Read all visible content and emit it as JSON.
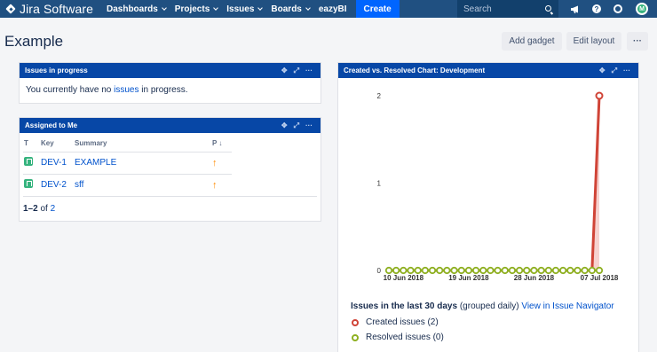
{
  "nav": {
    "logo": "Jira Software",
    "items": [
      {
        "label": "Dashboards"
      },
      {
        "label": "Projects"
      },
      {
        "label": "Issues"
      },
      {
        "label": "Boards"
      }
    ],
    "plain_item": "eazyBI",
    "create": "Create",
    "search_placeholder": "Search",
    "avatar_initial": "M"
  },
  "page": {
    "title": "Example",
    "add_gadget": "Add gadget",
    "edit_layout": "Edit layout",
    "more": "···"
  },
  "gadget_in_progress": {
    "title": "Issues in progress",
    "text_before": "You currently have no ",
    "link": "issues",
    "text_after": " in progress."
  },
  "gadget_assigned": {
    "title": "Assigned to Me",
    "columns": {
      "t": "T",
      "key": "Key",
      "summary": "Summary",
      "p": "P ↓"
    },
    "rows": [
      {
        "key": "DEV-1",
        "summary": "EXAMPLE",
        "priority": "↑"
      },
      {
        "key": "DEV-2",
        "summary": "sff",
        "priority": "↑"
      }
    ],
    "footer_range": "1–2",
    "footer_of": " of ",
    "footer_total": "2"
  },
  "gadget_chart": {
    "title": "Created vs. Resolved Chart: Development",
    "summary_bold": "Issues in the last 30 days",
    "summary_note": " (grouped daily) ",
    "summary_link": "View in Issue Navigator",
    "legend": [
      {
        "label": "Created issues (2)",
        "color": "#d04437"
      },
      {
        "label": "Resolved issues (0)",
        "color": "#8eb021"
      }
    ]
  },
  "icons": {
    "move": "move-icon",
    "maximize": "maximize-icon",
    "more": "more-icon",
    "notifications": "megaphone-icon",
    "help": "help-icon",
    "settings": "gear-icon"
  },
  "chart_data": {
    "type": "line",
    "x": [
      "2018-06-08",
      "2018-06-09",
      "2018-06-10",
      "2018-06-11",
      "2018-06-12",
      "2018-06-13",
      "2018-06-14",
      "2018-06-15",
      "2018-06-16",
      "2018-06-17",
      "2018-06-18",
      "2018-06-19",
      "2018-06-20",
      "2018-06-21",
      "2018-06-22",
      "2018-06-23",
      "2018-06-24",
      "2018-06-25",
      "2018-06-26",
      "2018-06-27",
      "2018-06-28",
      "2018-06-29",
      "2018-06-30",
      "2018-07-01",
      "2018-07-02",
      "2018-07-03",
      "2018-07-04",
      "2018-07-05",
      "2018-07-06",
      "2018-07-07"
    ],
    "xticks": [
      "10 Jun 2018",
      "19 Jun 2018",
      "28 Jun 2018",
      "07 Jul 2018"
    ],
    "yticks": [
      "0",
      "1",
      "2"
    ],
    "ylim": [
      0,
      2
    ],
    "series": [
      {
        "name": "Created issues (2)",
        "color": "#d04437",
        "values": [
          0,
          0,
          0,
          0,
          0,
          0,
          0,
          0,
          0,
          0,
          0,
          0,
          0,
          0,
          0,
          0,
          0,
          0,
          0,
          0,
          0,
          0,
          0,
          0,
          0,
          0,
          0,
          0,
          0,
          2
        ]
      },
      {
        "name": "Resolved issues (0)",
        "color": "#8eb021",
        "values": [
          0,
          0,
          0,
          0,
          0,
          0,
          0,
          0,
          0,
          0,
          0,
          0,
          0,
          0,
          0,
          0,
          0,
          0,
          0,
          0,
          0,
          0,
          0,
          0,
          0,
          0,
          0,
          0,
          0,
          0
        ]
      }
    ]
  }
}
